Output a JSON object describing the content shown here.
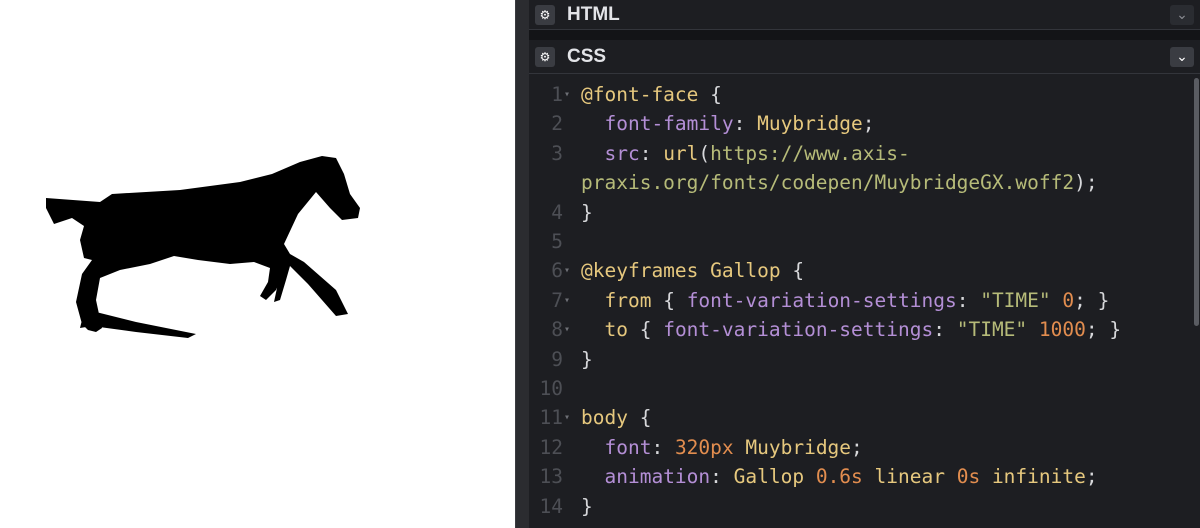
{
  "panels": {
    "html": {
      "title": "HTML",
      "gear_icon": "gear-icon",
      "toggle_icon": "chevron-down-icon"
    },
    "css": {
      "title": "CSS",
      "gear_icon": "gear-icon",
      "toggle_icon": "chevron-down-icon"
    }
  },
  "preview": {
    "image": "galloping-horse-silhouette",
    "color": "#000000"
  },
  "colors": {
    "editor_bg": "#1d1e22",
    "keyword": "#e6c87e",
    "property": "#b48fd6",
    "string": "#b6bb79",
    "number": "#e28d4f"
  },
  "code": {
    "line_numbers": [
      "1",
      "2",
      "3",
      "",
      "4",
      "5",
      "6",
      "7",
      "8",
      "9",
      "10",
      "11",
      "12",
      "13",
      "14"
    ],
    "lines": [
      [
        {
          "t": "@font-face",
          "c": "kw"
        },
        {
          "t": " {",
          "c": "pn"
        }
      ],
      [
        {
          "t": "  font-family",
          "c": "pr"
        },
        {
          "t": ": ",
          "c": "pn"
        },
        {
          "t": "Muybridge",
          "c": "vl"
        },
        {
          "t": ";",
          "c": "pn"
        }
      ],
      [
        {
          "t": "  src",
          "c": "pr"
        },
        {
          "t": ": ",
          "c": "pn"
        },
        {
          "t": "url",
          "c": "vl"
        },
        {
          "t": "(",
          "c": "pn"
        },
        {
          "t": "https://www.axis-",
          "c": "st"
        }
      ],
      [
        {
          "t": "praxis.org/fonts/codepen/MuybridgeGX.woff2",
          "c": "st"
        },
        {
          "t": ");",
          "c": "pn"
        }
      ],
      [
        {
          "t": "}",
          "c": "pn"
        }
      ],
      [],
      [
        {
          "t": "@keyframes",
          "c": "kw"
        },
        {
          "t": " Gallop",
          "c": "vl"
        },
        {
          "t": " {",
          "c": "pn"
        }
      ],
      [
        {
          "t": "  from",
          "c": "kw"
        },
        {
          "t": " { ",
          "c": "pn"
        },
        {
          "t": "font-variation-settings",
          "c": "pr"
        },
        {
          "t": ": ",
          "c": "pn"
        },
        {
          "t": "\"TIME\"",
          "c": "st"
        },
        {
          "t": " ",
          "c": "pn"
        },
        {
          "t": "0",
          "c": "nm"
        },
        {
          "t": "; }",
          "c": "pn"
        }
      ],
      [
        {
          "t": "  to",
          "c": "kw"
        },
        {
          "t": " { ",
          "c": "pn"
        },
        {
          "t": "font-variation-settings",
          "c": "pr"
        },
        {
          "t": ": ",
          "c": "pn"
        },
        {
          "t": "\"TIME\"",
          "c": "st"
        },
        {
          "t": " ",
          "c": "pn"
        },
        {
          "t": "1000",
          "c": "nm"
        },
        {
          "t": "; }",
          "c": "pn"
        }
      ],
      [
        {
          "t": "}",
          "c": "pn"
        }
      ],
      [],
      [
        {
          "t": "body",
          "c": "kw"
        },
        {
          "t": " {",
          "c": "pn"
        }
      ],
      [
        {
          "t": "  font",
          "c": "pr"
        },
        {
          "t": ": ",
          "c": "pn"
        },
        {
          "t": "320px",
          "c": "nm"
        },
        {
          "t": " Muybridge",
          "c": "vl"
        },
        {
          "t": ";",
          "c": "pn"
        }
      ],
      [
        {
          "t": "  animation",
          "c": "pr"
        },
        {
          "t": ": ",
          "c": "pn"
        },
        {
          "t": "Gallop",
          "c": "vl"
        },
        {
          "t": " ",
          "c": "pn"
        },
        {
          "t": "0.6s",
          "c": "nm"
        },
        {
          "t": " linear ",
          "c": "vl"
        },
        {
          "t": "0s",
          "c": "nm"
        },
        {
          "t": " infinite",
          "c": "vl"
        },
        {
          "t": ";",
          "c": "pn"
        }
      ],
      [
        {
          "t": "}",
          "c": "pn"
        }
      ]
    ],
    "foldable_lines": [
      "1",
      "6",
      "7",
      "8",
      "11"
    ]
  }
}
